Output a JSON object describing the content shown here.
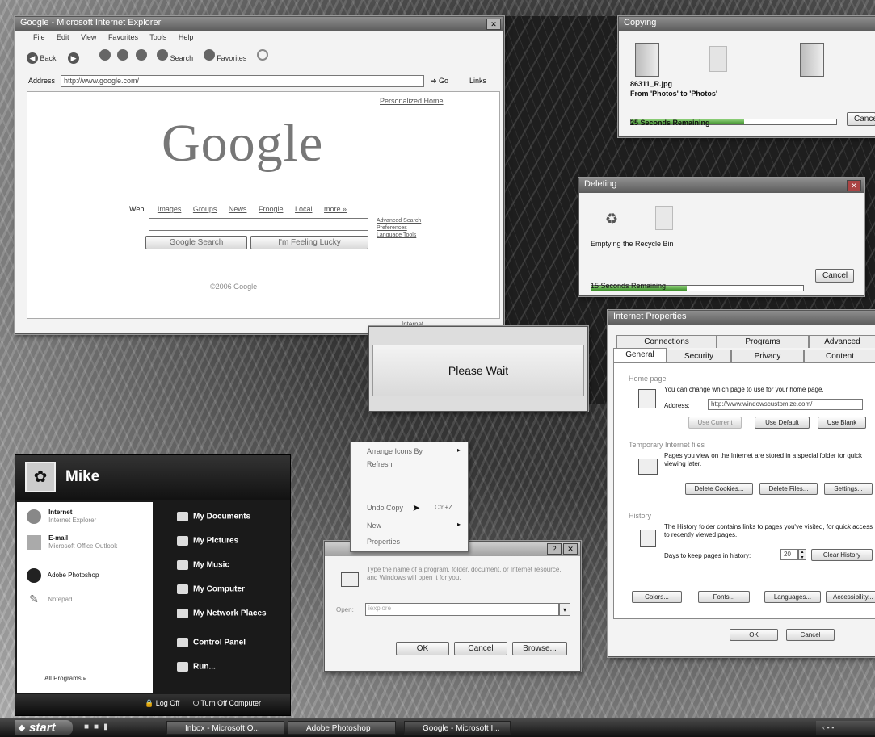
{
  "ie_window": {
    "title": "Google - Microsoft Internet Explorer",
    "menu": [
      "File",
      "Edit",
      "View",
      "Favorites",
      "Tools",
      "Help"
    ],
    "toolbar": {
      "back": "Back",
      "search": "Search",
      "favorites": "Favorites"
    },
    "address_label": "Address",
    "address_value": "http://www.google.com/",
    "go_label": "Go",
    "links_label": "Links",
    "personalized_home": "Personalized Home",
    "logo": "Google",
    "search_tabs": [
      "Web",
      "Images",
      "Groups",
      "News",
      "Froogle",
      "Local",
      "more »"
    ],
    "side_links": [
      "Advanced Search",
      "Preferences",
      "Language Tools"
    ],
    "search_button": "Google Search",
    "lucky_button": "I'm Feeling Lucky",
    "footer": "©2006 Google",
    "status_zone": "Internet"
  },
  "copying_dialog": {
    "title": "Copying",
    "file": "86311_R.jpg",
    "from_to": "From 'Photos' to 'Photos'",
    "progress": 0.55,
    "remaining": "25 Seconds Remaining",
    "cancel": "Cancel"
  },
  "deleting_dialog": {
    "title": "Deleting",
    "status": "Emptying the Recycle Bin",
    "progress": 0.45,
    "remaining": "15 Seconds Remaining",
    "cancel": "Cancel"
  },
  "please_wait": {
    "text": "Please Wait"
  },
  "internet_properties": {
    "title": "Internet Properties",
    "tabs_back": [
      "Connections",
      "Programs",
      "Advanced"
    ],
    "tabs_front": [
      "General",
      "Security",
      "Privacy",
      "Content"
    ],
    "home_page": {
      "heading": "Home page",
      "desc": "You can change which page to use for your home page.",
      "address_label": "Address:",
      "address_value": "http://www.windowscustomize.com/",
      "use_current": "Use Current",
      "use_default": "Use Default",
      "use_blank": "Use Blank"
    },
    "temp_files": {
      "heading": "Temporary Internet files",
      "desc": "Pages you view on the Internet are stored in a special folder for quick viewing later.",
      "delete_cookies": "Delete Cookies...",
      "delete_files": "Delete Files...",
      "settings": "Settings..."
    },
    "history": {
      "heading": "History",
      "desc": "The History folder contains links to pages you've visited, for quick access to recently viewed pages.",
      "days_label": "Days to keep pages in history:",
      "days_value": "20",
      "clear": "Clear History"
    },
    "bottom_buttons": [
      "Colors...",
      "Fonts...",
      "Languages...",
      "Accessibility..."
    ],
    "ok": "OK",
    "cancel": "Cancel"
  },
  "run_dialog": {
    "desc": "Type the name of a program, folder, document, or Internet resource, and Windows will open it for you.",
    "open_label": "Open:",
    "open_value": "iexplore",
    "ok": "OK",
    "cancel": "Cancel",
    "browse": "Browse..."
  },
  "context_menu": {
    "items": [
      "Arrange Icons By",
      "Refresh",
      "Undo Copy",
      "Ctrl+Z",
      "New",
      "Properties"
    ]
  },
  "start_menu": {
    "user": "Mike",
    "pinned": [
      {
        "title": "Internet",
        "sub": "Internet Explorer"
      },
      {
        "title": "E-mail",
        "sub": "Microsoft Office Outlook"
      }
    ],
    "recent": [
      "Adobe Photoshop",
      "Notepad"
    ],
    "all_programs": "All Programs",
    "right_items": [
      "My Documents",
      "My Pictures",
      "My Music",
      "My Computer",
      "My Network Places",
      "Control Panel",
      "Run..."
    ],
    "log_off": "Log Off",
    "turn_off": "Turn Off Computer"
  },
  "taskbar": {
    "start": "start",
    "tasks": [
      "Inbox - Microsoft O...",
      "Adobe Photoshop",
      "Google - Microsoft I..."
    ]
  }
}
